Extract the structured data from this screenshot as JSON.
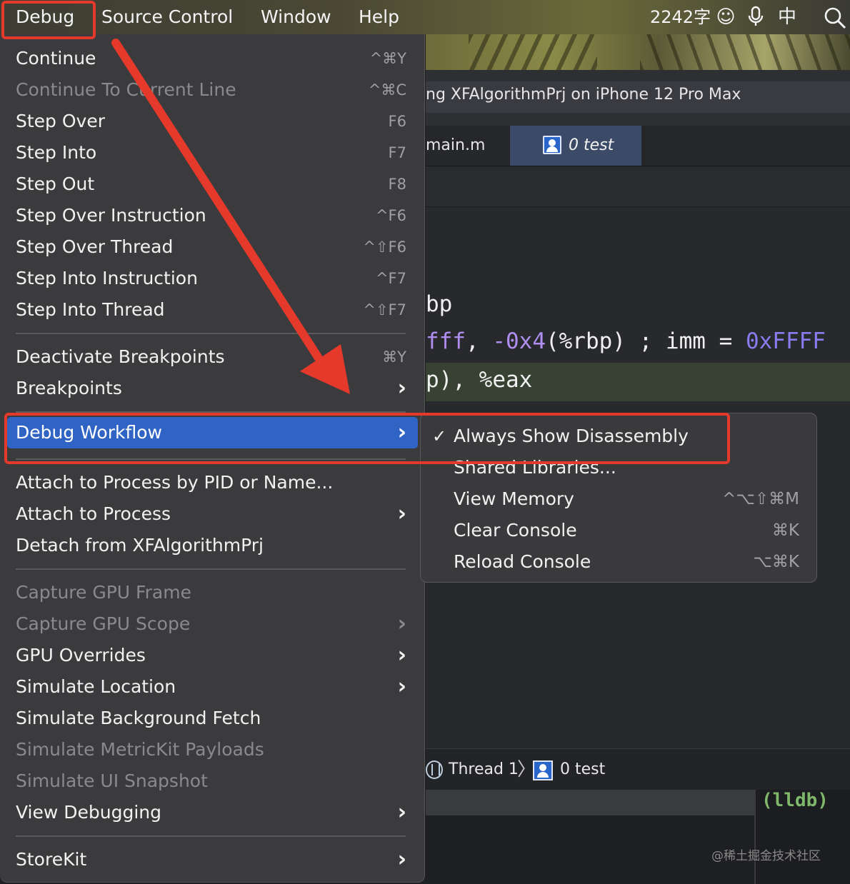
{
  "menubar": {
    "items": [
      "Debug",
      "Source Control",
      "Window",
      "Help"
    ],
    "word_count": "2242字",
    "input_method": "中"
  },
  "xcode": {
    "title": "ng XFAlgorithmPrj on iPhone 12 Pro Max",
    "tabs": [
      "main.m",
      "0 test"
    ],
    "code_lines": [
      {
        "parts": [
          {
            "t": "bp",
            "c": "reg"
          }
        ]
      },
      {
        "parts": [
          {
            "t": "fff",
            "c": "num"
          },
          {
            "t": ", ",
            "c": "reg"
          },
          {
            "t": "-0x4",
            "c": "num"
          },
          {
            "t": "(%rbp)    ; imm = ",
            "c": "reg"
          },
          {
            "t": "0xFFFF",
            "c": "imm"
          }
        ]
      },
      {
        "parts": [
          {
            "t": "p), %eax",
            "c": "reg"
          }
        ]
      }
    ],
    "debug_bar": {
      "thread": "Thread 1",
      "frame": "0 test"
    },
    "console_prompt": "(lldb)",
    "watermark": "@稀土掘金技术社区"
  },
  "debug_menu": {
    "items": [
      {
        "label": "Continue",
        "shortcut": "^⌘Y",
        "enabled": true
      },
      {
        "label": "Continue To Current Line",
        "shortcut": "^⌘C",
        "enabled": false
      },
      {
        "label": "Step Over",
        "shortcut": "F6",
        "enabled": true
      },
      {
        "label": "Step Into",
        "shortcut": "F7",
        "enabled": true
      },
      {
        "label": "Step Out",
        "shortcut": "F8",
        "enabled": true
      },
      {
        "label": "Step Over Instruction",
        "shortcut": "^F6",
        "enabled": true
      },
      {
        "label": "Step Over Thread",
        "shortcut": "^⇧F6",
        "enabled": true
      },
      {
        "label": "Step Into Instruction",
        "shortcut": "^F7",
        "enabled": true
      },
      {
        "label": "Step Into Thread",
        "shortcut": "^⇧F7",
        "enabled": true
      },
      {
        "label": "Deactivate Breakpoints",
        "shortcut": "⌘Y",
        "enabled": true
      },
      {
        "label": "Breakpoints",
        "submenu": true,
        "enabled": true
      },
      {
        "label": "Debug Workflow",
        "submenu": true,
        "enabled": true,
        "selected": true
      },
      {
        "label": "Attach to Process by PID or Name...",
        "enabled": true
      },
      {
        "label": "Attach to Process",
        "submenu": true,
        "enabled": true
      },
      {
        "label": "Detach from XFAlgorithmPrj",
        "enabled": true
      },
      {
        "label": "Capture GPU Frame",
        "enabled": false
      },
      {
        "label": "Capture GPU Scope",
        "submenu": true,
        "enabled": false
      },
      {
        "label": "GPU Overrides",
        "submenu": true,
        "enabled": true
      },
      {
        "label": "Simulate Location",
        "submenu": true,
        "enabled": true
      },
      {
        "label": "Simulate Background Fetch",
        "enabled": true
      },
      {
        "label": "Simulate MetricKit Payloads",
        "enabled": false
      },
      {
        "label": "Simulate UI Snapshot",
        "enabled": false
      },
      {
        "label": "View Debugging",
        "submenu": true,
        "enabled": true
      },
      {
        "label": "StoreKit",
        "submenu": true,
        "enabled": true
      }
    ]
  },
  "workflow_submenu": {
    "items": [
      {
        "label": "Always Show Disassembly",
        "checked": true,
        "shortcut": ""
      },
      {
        "label": "Shared Libraries...",
        "checked": false,
        "shortcut": ""
      },
      {
        "label": "View Memory",
        "checked": false,
        "shortcut": "^⌥⇧⌘M"
      },
      {
        "label": "Clear Console",
        "checked": false,
        "shortcut": "⌘K"
      },
      {
        "label": "Reload Console",
        "checked": false,
        "shortcut": "⌥⌘K"
      }
    ]
  },
  "colors": {
    "annotation_red": "#e5392b",
    "selection_blue": "#2f63c4"
  }
}
